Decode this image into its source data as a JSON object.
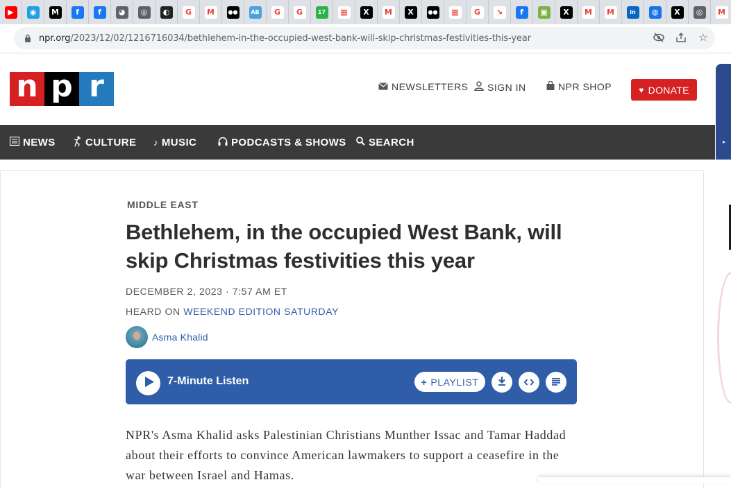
{
  "browser": {
    "tabs": [
      {
        "icon": "youtube-icon",
        "color": "#ff0000",
        "glyph": "▶"
      },
      {
        "icon": "edge-icon",
        "color": "#1fa0e5",
        "glyph": "◉"
      },
      {
        "icon": "medium-icon",
        "color": "#000000",
        "glyph": "M"
      },
      {
        "icon": "facebook-icon",
        "color": "#1877f2",
        "glyph": "f"
      },
      {
        "icon": "facebook-icon",
        "color": "#1877f2",
        "glyph": "f"
      },
      {
        "icon": "globe-icon",
        "color": "#5f6368",
        "glyph": "◕"
      },
      {
        "icon": "chrome-icon",
        "color": "#5f6368",
        "glyph": "◎"
      },
      {
        "icon": "cursor-icon",
        "color": "#222222",
        "glyph": "◐"
      },
      {
        "icon": "google-icon",
        "color": "#ffffff",
        "glyph": "G"
      },
      {
        "icon": "gmail-icon",
        "color": "#ffffff",
        "glyph": "M"
      },
      {
        "icon": "dots-icon",
        "color": "#000000",
        "glyph": "●●"
      },
      {
        "icon": "ab-icon",
        "color": "#4aa3df",
        "glyph": "AB"
      },
      {
        "icon": "google-icon",
        "color": "#ffffff",
        "glyph": "G"
      },
      {
        "icon": "google-icon",
        "color": "#ffffff",
        "glyph": "G"
      },
      {
        "icon": "badge-icon",
        "color": "#2bb34a",
        "glyph": "17"
      },
      {
        "icon": "chart-icon",
        "color": "#ffffff",
        "glyph": "▦"
      },
      {
        "icon": "x-icon",
        "color": "#000000",
        "glyph": "X"
      },
      {
        "icon": "gmail-icon",
        "color": "#ffffff",
        "glyph": "M"
      },
      {
        "icon": "x-icon",
        "color": "#000000",
        "glyph": "X"
      },
      {
        "icon": "dots-icon",
        "color": "#000000",
        "glyph": "●●"
      },
      {
        "icon": "grid-icon",
        "color": "#ffffff",
        "glyph": "▦"
      },
      {
        "icon": "google-icon",
        "color": "#ffffff",
        "glyph": "G"
      },
      {
        "icon": "arrow-icon",
        "color": "#ffffff",
        "glyph": "↘"
      },
      {
        "icon": "facebook-icon",
        "color": "#1877f2",
        "glyph": "f"
      },
      {
        "icon": "image-icon",
        "color": "#7cb342",
        "glyph": "▣"
      },
      {
        "icon": "x-icon",
        "color": "#000000",
        "glyph": "X"
      },
      {
        "icon": "gmail-icon",
        "color": "#ffffff",
        "glyph": "M"
      },
      {
        "icon": "gmail-icon",
        "color": "#ffffff",
        "glyph": "M"
      },
      {
        "icon": "linkedin-icon",
        "color": "#0a66c2",
        "glyph": "in"
      },
      {
        "icon": "globe-icon",
        "color": "#1a73e8",
        "glyph": "◍"
      },
      {
        "icon": "x-icon",
        "color": "#000000",
        "glyph": "X"
      },
      {
        "icon": "chrome-icon",
        "color": "#5f6368",
        "glyph": "◎"
      },
      {
        "icon": "gmail-icon",
        "color": "#ffffff",
        "glyph": "M"
      }
    ],
    "url_host": "npr.org",
    "url_path": "/2023/12/02/1216716034/bethlehem-in-the-occupied-west-bank-will-skip-christmas-festivities-this-year"
  },
  "header": {
    "logo": [
      "n",
      "p",
      "r"
    ],
    "newsletters": "NEWSLETTERS",
    "sign_in": "SIGN IN",
    "shop": "NPR SHOP",
    "donate": "DONATE"
  },
  "nav": {
    "news": "NEWS",
    "culture": "CULTURE",
    "music": "MUSIC",
    "podcasts": "PODCASTS & SHOWS",
    "search": "SEARCH"
  },
  "article": {
    "kicker": "MIDDLE EAST",
    "headline": "Bethlehem, in the occupied West Bank, will skip Christmas festivities this year",
    "date": "DECEMBER 2, 2023 · 7:57 AM ET",
    "heard_on_label": "HEARD ON ",
    "heard_on_show": "WEEKEND EDITION SATURDAY",
    "author": "Asma Khalid",
    "player": {
      "listen": "7-Minute Listen",
      "playlist": "PLAYLIST"
    },
    "body": "NPR's Asma Khalid asks Palestinian Christians Munther Issac and Tamar Haddad about their efforts to convince American lawmakers to support a ceasefire in the war between Israel and Hamas."
  },
  "colors": {
    "npr_red": "#d62021",
    "npr_blue": "#237bbd",
    "player_blue": "#2f5da8",
    "nav_bg": "#3a3a3a"
  }
}
